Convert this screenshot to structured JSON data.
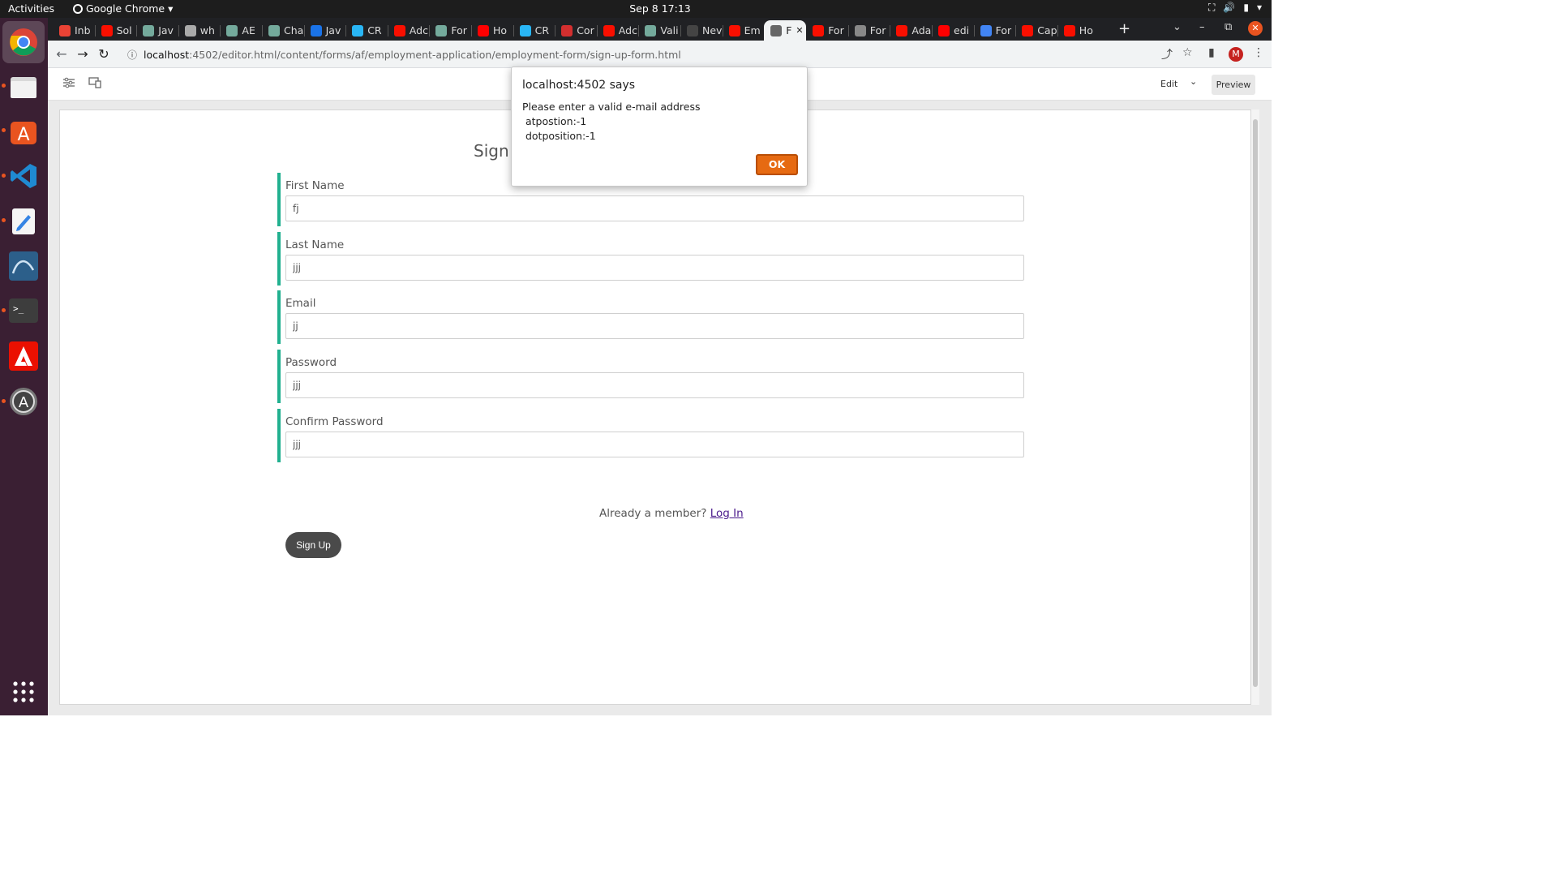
{
  "topbar": {
    "activities": "Activities",
    "app_name": "Google Chrome",
    "clock": "Sep 8  17:13"
  },
  "browser": {
    "tabs": [
      {
        "label": "Inb",
        "color": "#ea4335"
      },
      {
        "label": "Sol",
        "color": "#fa0f00"
      },
      {
        "label": "Jav",
        "color": "#74aa9c"
      },
      {
        "label": "wh",
        "color": "#aaaaaa"
      },
      {
        "label": "AE",
        "color": "#74aa9c"
      },
      {
        "label": "Cha",
        "color": "#74aa9c"
      },
      {
        "label": "Jav",
        "color": "#1a73e8"
      },
      {
        "label": "CR",
        "color": "#29b6f6"
      },
      {
        "label": "Adc",
        "color": "#fa0f00"
      },
      {
        "label": "For",
        "color": "#74aa9c"
      },
      {
        "label": "Ho",
        "color": "#ff0000"
      },
      {
        "label": "CR",
        "color": "#29b6f6"
      },
      {
        "label": "Cor",
        "color": "#d32f2f"
      },
      {
        "label": "Adc",
        "color": "#fa0f00"
      },
      {
        "label": "Vali",
        "color": "#74aa9c"
      },
      {
        "label": "Nev",
        "color": "#444444"
      },
      {
        "label": "Em",
        "color": "#fa0f00"
      },
      {
        "label": "F",
        "color": "#666666"
      },
      {
        "label": "For",
        "color": "#fa0f00"
      },
      {
        "label": "For",
        "color": "#888888"
      },
      {
        "label": "Ada",
        "color": "#fa0f00"
      },
      {
        "label": "edi",
        "color": "#ff0000"
      },
      {
        "label": "For",
        "color": "#4285f4"
      },
      {
        "label": "Cap",
        "color": "#fa0f00"
      },
      {
        "label": "Ho",
        "color": "#fa0f00"
      }
    ],
    "active_tab_index": 17,
    "url_host": "localhost",
    "url_path": ":4502/editor.html/content/forms/af/employment-application/employment-form/sign-up-form.html",
    "profile_initial": "M"
  },
  "editor": {
    "mode_label": "Edit",
    "preview_label": "Preview"
  },
  "form": {
    "title": "Sign",
    "fields": [
      {
        "label": "First Name",
        "value": "fj"
      },
      {
        "label": "Last Name",
        "value": "jjj"
      },
      {
        "label": "Email",
        "value": "jj"
      },
      {
        "label": "Password",
        "value": "jjj"
      },
      {
        "label": "Confirm Password",
        "value": "jjj"
      }
    ],
    "member_text": "Already a member?",
    "login_link": "Log In",
    "signup_button": "Sign Up"
  },
  "alert": {
    "title": "localhost:4502 says",
    "line1": "Please enter a valid e-mail address",
    "line2": " atpostion:-1",
    "line3": " dotposition:-1",
    "ok_label": "OK"
  },
  "colors": {
    "accent_green": "#21b08f",
    "ok_orange": "#e66a12",
    "dock_bg": "#3a1f33"
  }
}
